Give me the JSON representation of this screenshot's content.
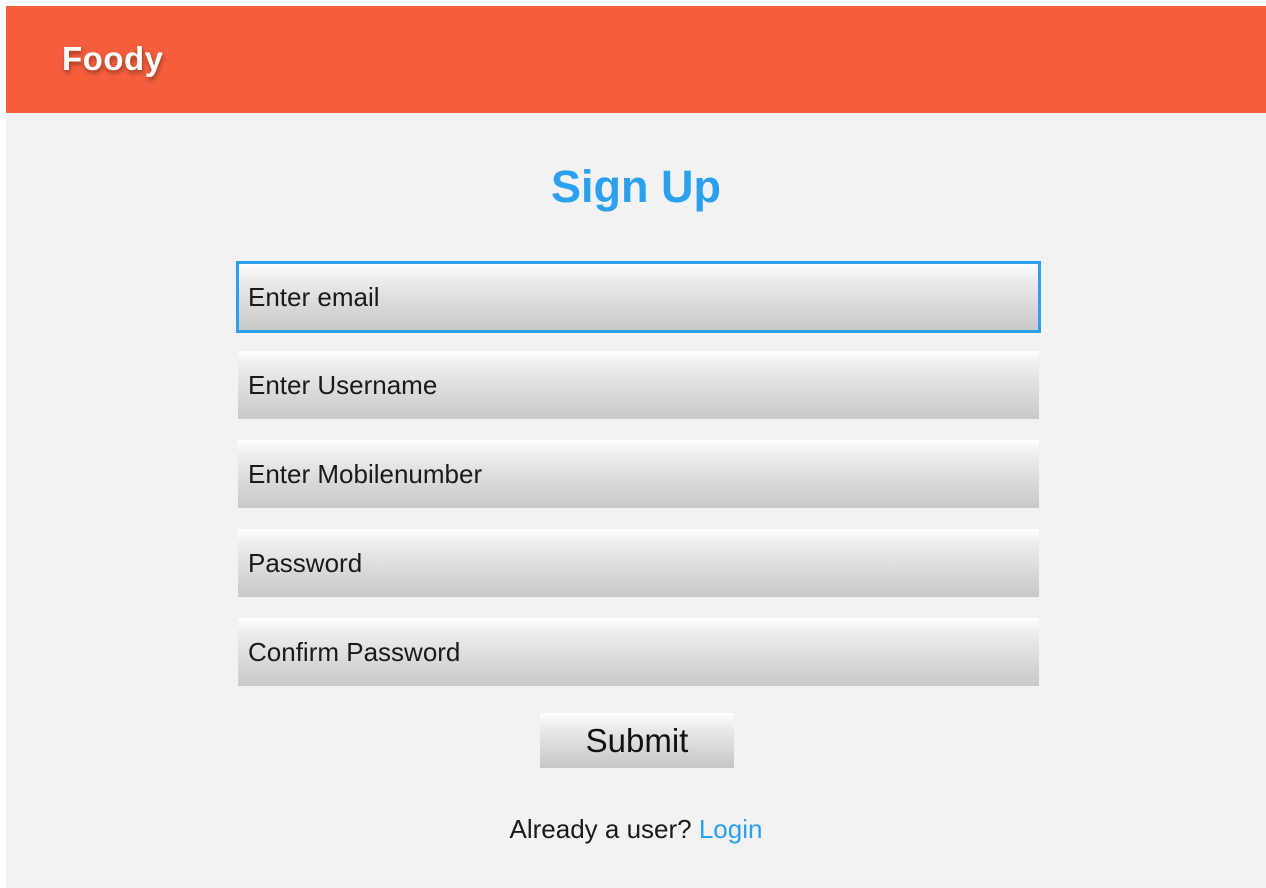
{
  "appbar": {
    "title": "Foody"
  },
  "page": {
    "title": "Sign Up"
  },
  "form": {
    "email": {
      "placeholder": "Enter email",
      "value": ""
    },
    "username": {
      "placeholder": "Enter Username",
      "value": ""
    },
    "mobile": {
      "placeholder": "Enter Mobilenumber",
      "value": ""
    },
    "password": {
      "placeholder": "Password",
      "value": ""
    },
    "confirm_password": {
      "placeholder": "Confirm Password",
      "value": ""
    },
    "submit_label": "Submit"
  },
  "footer": {
    "prompt": "Already a user? ",
    "login_label": "Login"
  },
  "colors": {
    "appbar": "#f45e3d",
    "accent": "#2aa0ee",
    "background": "#f2f2f2"
  }
}
